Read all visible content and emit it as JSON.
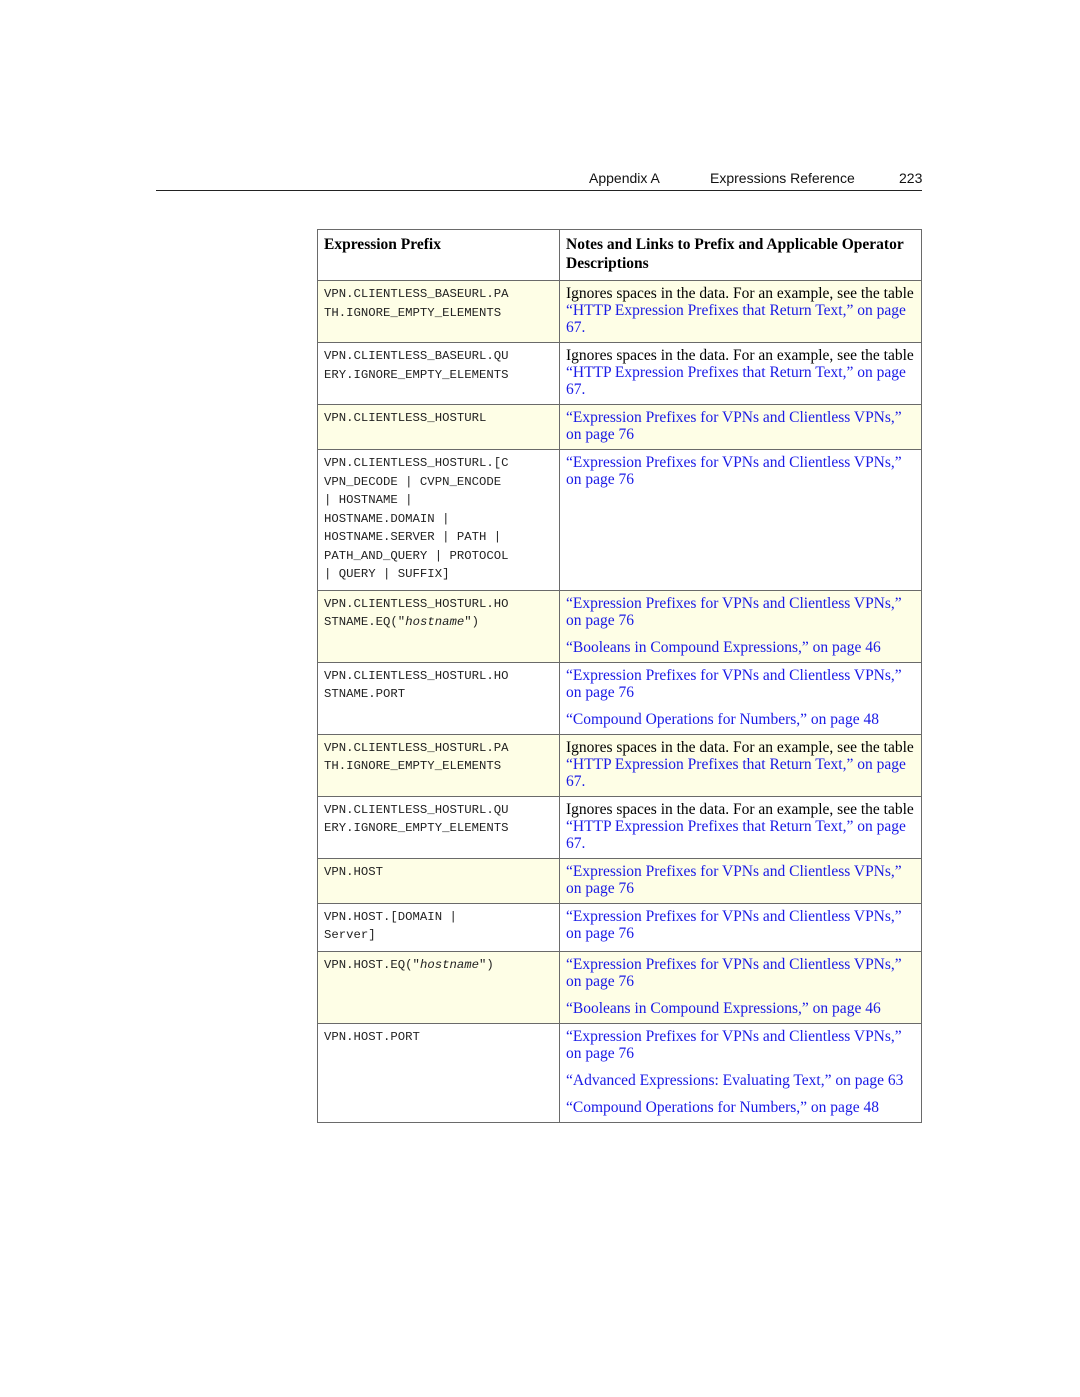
{
  "header": {
    "section": "Appendix A",
    "chapter": "Expressions Reference",
    "page_number": "223"
  },
  "table": {
    "columns": [
      "Expression Prefix",
      "Notes and Links to Prefix and Applicable Operator Descriptions"
    ],
    "rows": [
      {
        "highlight": true,
        "prefix": [
          "VPN.CLIENTLESS_BASEURL.PA",
          "TH.IGNORE_EMPTY_ELEMENTS"
        ],
        "notes": [
          {
            "text": "Ignores spaces in the data. For an example, see the table ",
            "link": "“HTTP Expression Prefixes that Return Text,” on page 67",
            "tail": "."
          }
        ]
      },
      {
        "highlight": false,
        "prefix": [
          "VPN.CLIENTLESS_BASEURL.QU",
          "ERY.IGNORE_EMPTY_ELEMENTS"
        ],
        "notes": [
          {
            "text": "Ignores spaces in the data. For an example, see the table ",
            "link": "“HTTP Expression Prefixes that Return Text,” on page 67",
            "tail": "."
          }
        ]
      },
      {
        "highlight": true,
        "prefix": [
          "VPN.CLIENTLESS_HOSTURL"
        ],
        "notes": [
          {
            "text": "",
            "link": "“Expression Prefixes for VPNs and Clientless VPNs,” on page 76",
            "tail": ""
          }
        ]
      },
      {
        "highlight": false,
        "prefix": [
          "VPN.CLIENTLESS_HOSTURL.[C",
          "VPN_DECODE | CVPN_ENCODE",
          "| HOSTNAME |",
          "HOSTNAME.DOMAIN |",
          "HOSTNAME.SERVER | PATH |",
          "PATH_AND_QUERY | PROTOCOL",
          "| QUERY | SUFFIX]"
        ],
        "notes": [
          {
            "text": "",
            "link": "“Expression Prefixes for VPNs and Clientless VPNs,” on page 76",
            "tail": ""
          }
        ]
      },
      {
        "highlight": true,
        "prefix": [
          "VPN.CLIENTLESS_HOSTURL.HO",
          "STNAME.EQ(\"",
          "hostname",
          "\")"
        ],
        "notes": [
          {
            "text": "",
            "link": "“Expression Prefixes for VPNs and Clientless VPNs,” on page 76",
            "tail": ""
          },
          {
            "text": "",
            "link": "“Booleans in Compound Expressions,” on page 46",
            "tail": ""
          }
        ]
      },
      {
        "highlight": false,
        "prefix": [
          "VPN.CLIENTLESS_HOSTURL.HO",
          "STNAME.PORT"
        ],
        "notes": [
          {
            "text": "",
            "link": "“Expression Prefixes for VPNs and Clientless VPNs,” on page 76",
            "tail": ""
          },
          {
            "text": "",
            "link": "“Compound Operations for Numbers,” on page 48",
            "tail": ""
          }
        ]
      },
      {
        "highlight": true,
        "prefix": [
          "VPN.CLIENTLESS_HOSTURL.PA",
          "TH.IGNORE_EMPTY_ELEMENTS"
        ],
        "notes": [
          {
            "text": "Ignores spaces in the data. For an example, see the table ",
            "link": "“HTTP Expression Prefixes that Return Text,” on page 67",
            "tail": "."
          }
        ]
      },
      {
        "highlight": false,
        "prefix": [
          "VPN.CLIENTLESS_HOSTURL.QU",
          "ERY.IGNORE_EMPTY_ELEMENTS"
        ],
        "notes": [
          {
            "text": "Ignores spaces in the data. For an example, see the table ",
            "link": "“HTTP Expression Prefixes that Return Text,” on page 67",
            "tail": "."
          }
        ]
      },
      {
        "highlight": true,
        "prefix": [
          "VPN.HOST"
        ],
        "notes": [
          {
            "text": "",
            "link": "“Expression Prefixes for VPNs and Clientless VPNs,” on page 76",
            "tail": ""
          }
        ]
      },
      {
        "highlight": false,
        "prefix": [
          "VPN.HOST.[DOMAIN |",
          "Server]"
        ],
        "notes": [
          {
            "text": "",
            "link": "“Expression Prefixes for VPNs and Clientless VPNs,” on page 76",
            "tail": ""
          }
        ]
      },
      {
        "highlight": true,
        "prefix": [
          "VPN.HOST.EQ(\"",
          "hostname",
          "\")"
        ],
        "notes": [
          {
            "text": "",
            "link": "“Expression Prefixes for VPNs and Clientless VPNs,” on page 76",
            "tail": ""
          },
          {
            "text": "",
            "link": "“Booleans in Compound Expressions,” on page 46",
            "tail": ""
          }
        ]
      },
      {
        "highlight": false,
        "prefix": [
          "VPN.HOST.PORT"
        ],
        "notes": [
          {
            "text": "",
            "link": "“Expression Prefixes for VPNs and Clientless VPNs,” on page 76",
            "tail": ""
          },
          {
            "text": "",
            "link": "“Advanced Expressions: Evaluating Text,” on page 63",
            "tail": ""
          },
          {
            "text": "",
            "link": "“Compound Operations for Numbers,” on page 48",
            "tail": ""
          }
        ]
      }
    ]
  }
}
